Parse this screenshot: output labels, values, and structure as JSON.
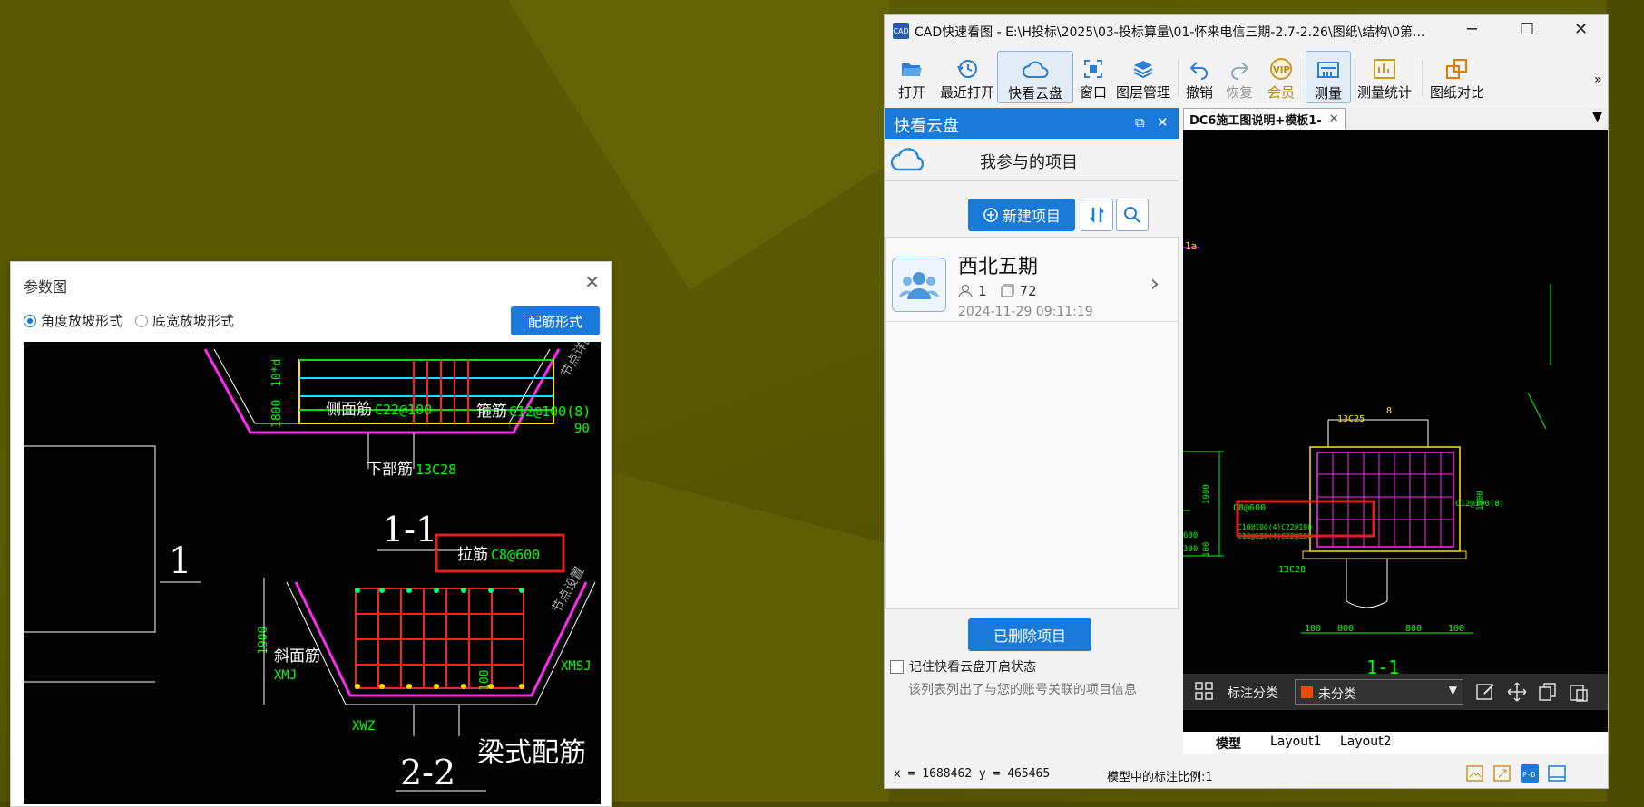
{
  "param_dialog": {
    "title": "参数图",
    "radio_angle": "角度放坡形式",
    "radio_width": "底宽放坡形式",
    "rebar_button": "配筋形式",
    "drawing": {
      "side_bar": "侧面筋",
      "side_bar_spec": "C22@100",
      "stirrup": "箍筋",
      "stirrup_spec": "C12@100(8)",
      "bottom_bar": "下部筋",
      "bottom_bar_spec": "13C28",
      "section_1": "1-1",
      "tie_bar": "拉筋",
      "tie_bar_spec": "C8@600",
      "slope_bar": "斜面筋",
      "slope_code": "XMJ",
      "xmsj": "XMSJ",
      "xwz": "XWZ",
      "dim_1900": "1900",
      "dim_1800": "1800",
      "dim_10d": "10*d",
      "dim_90": "90",
      "node_text": "节点详图",
      "node_text2": "节点设置",
      "big_1": "1",
      "section_2": "2-2",
      "title_text": "梁式配筋",
      "dim_100": "100"
    }
  },
  "window": {
    "title": "CAD快速看图 - E:\\H投标\\2025\\03-投标算量\\01-怀来电信三期-2.7-2.26\\图纸\\结构\\0第...",
    "app_icon_text": "CAD",
    "minimize": "─",
    "maximize": "☐",
    "close": "✕",
    "toolbar": {
      "open": "打开",
      "recent": "最近打开",
      "cloud": "快看云盘",
      "window": "窗口",
      "layers": "图层管理",
      "undo": "撤销",
      "redo": "恢复",
      "vip": "会员",
      "vip_badge": "VIP",
      "measure": "测量",
      "measure_stats": "测量统计",
      "compare": "图纸对比",
      "more": "»"
    }
  },
  "cloud_panel": {
    "title": "快看云盘",
    "restore_icon": "⧉",
    "close_icon": "✕",
    "subtitle": "我参与的项目",
    "new_project": "新建项目",
    "project": {
      "name": "西北五期",
      "members": "1",
      "files": "72",
      "date": "2024-11-29 09:11:19",
      "chevron": "›"
    },
    "deleted_projects": "已删除项目",
    "remember": "记住快看云盘开启状态",
    "hint": "该列表列出了与您的账号关联的项目信息"
  },
  "drawing": {
    "tab": "DC6施工图说明+模板1-",
    "tab_close": "✕",
    "dropdown": "▼",
    "annotation_label": "标注分类",
    "category": "未分类",
    "category_color": "#ec4a0a",
    "select_arrow": "▼",
    "layouts": [
      "模型",
      "Layout1",
      "Layout2"
    ],
    "section_label": "1-1",
    "corner_label": "1a",
    "cad": {
      "top_bar": "13C25",
      "tie": "C8@600",
      "stirrup": "C12@100(8)",
      "side1": "C10@100(4)C22@100",
      "side2": "C10@100(4)C22@100",
      "bottom": "13C28",
      "d100a": "100",
      "d800a": "800",
      "d800b": "800",
      "d100b": "100",
      "v1900": "1900",
      "v100": "100",
      "v1800": "1800",
      "l600": "600",
      "l300": "300",
      "t8": "8"
    }
  },
  "status": {
    "coords": "x = 1688462  y = 465465",
    "scale": "模型中的标注比例:1"
  },
  "colors": {
    "accent": "#1a7ad9",
    "highlight": "#e02020"
  }
}
